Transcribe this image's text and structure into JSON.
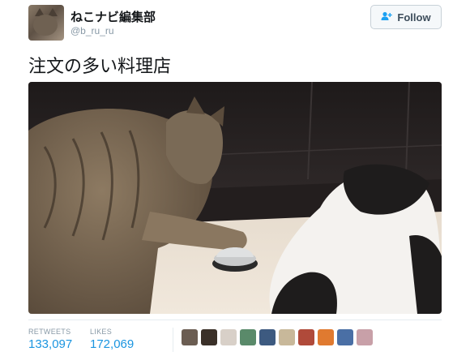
{
  "account": {
    "name": "ねこナビ編集部",
    "handle": "@b_ru_ru"
  },
  "follow_label": "Follow",
  "tweet_text": "注文の多い料理店",
  "stats": {
    "retweets_label": "RETWEETS",
    "retweets_value": "133,097",
    "likes_label": "LIKES",
    "likes_value": "172,069"
  },
  "likers": [
    {
      "color": "#6b5d52"
    },
    {
      "color": "#3a3028"
    },
    {
      "color": "#d8d0c8"
    },
    {
      "color": "#5a8a6a"
    },
    {
      "color": "#3d5a80"
    },
    {
      "color": "#c8b89a"
    },
    {
      "color": "#b04a3a"
    },
    {
      "color": "#e07a30"
    },
    {
      "color": "#4a6fa5"
    },
    {
      "color": "#c8a0a8"
    }
  ],
  "icons": {
    "follow": "add-user-icon"
  }
}
